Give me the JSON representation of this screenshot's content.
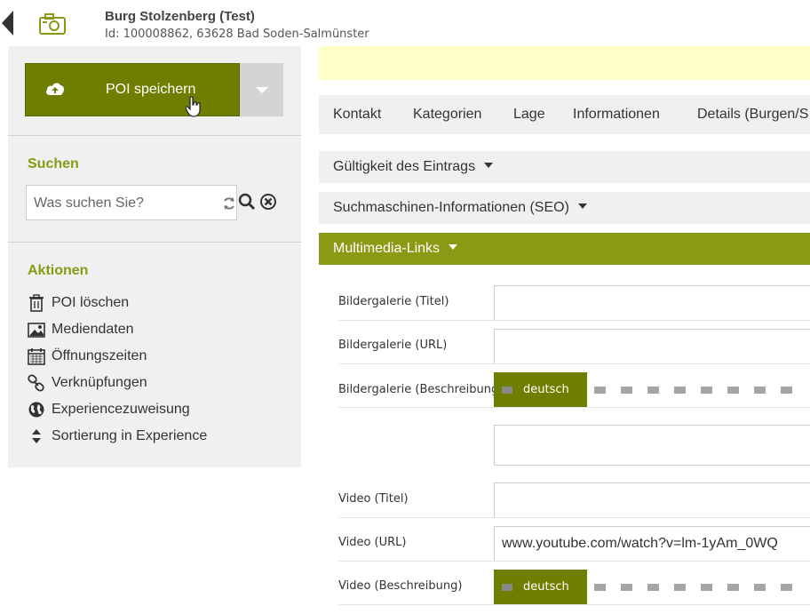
{
  "header": {
    "title": "Burg Stolzenberg (Test)",
    "subtitle": "Id: 100008862, 63628 Bad Soden-Salmünster"
  },
  "sidebar": {
    "save_label": "POI speichern",
    "search_title": "Suchen",
    "search_placeholder": "Was suchen Sie?",
    "actions_title": "Aktionen",
    "actions": [
      {
        "label": "POI löschen",
        "icon": "trash-icon"
      },
      {
        "label": "Mediendaten",
        "icon": "image-icon"
      },
      {
        "label": "Öffnungszeiten",
        "icon": "calendar-icon"
      },
      {
        "label": "Verknüpfungen",
        "icon": "link-icon"
      },
      {
        "label": "Experiencezuweisung",
        "icon": "globe-icon"
      },
      {
        "label": "Sortierung in Experience",
        "icon": "sort-icon"
      }
    ]
  },
  "tabs": [
    "Kontakt",
    "Kategorien",
    "Lage",
    "Informationen",
    "Details (Burgen/S"
  ],
  "accordions": [
    {
      "label": "Gültigkeit des Eintrags"
    },
    {
      "label": "Suchmaschinen-Informationen (SEO)"
    },
    {
      "label": "Multimedia-Links"
    }
  ],
  "fields": {
    "gallery_title": {
      "label": "Bildergalerie (Titel)",
      "value": ""
    },
    "gallery_url": {
      "label": "Bildergalerie (URL)",
      "value": ""
    },
    "gallery_desc": {
      "label": "Bildergalerie (Beschreibung)",
      "value": ""
    },
    "video_title": {
      "label": "Video (Titel)",
      "value": ""
    },
    "video_url": {
      "label": "Video (URL)",
      "value": "www.youtube.com/watch?v=lm-1yAm_0WQ"
    },
    "video_desc": {
      "label": "Video (Beschreibung)",
      "value": ""
    }
  },
  "language": {
    "active": "deutsch"
  },
  "colors": {
    "accent": "#8a9a15",
    "button": "#6e7f00",
    "notice": "#ffffc8",
    "panel": "#f0f0f0"
  }
}
